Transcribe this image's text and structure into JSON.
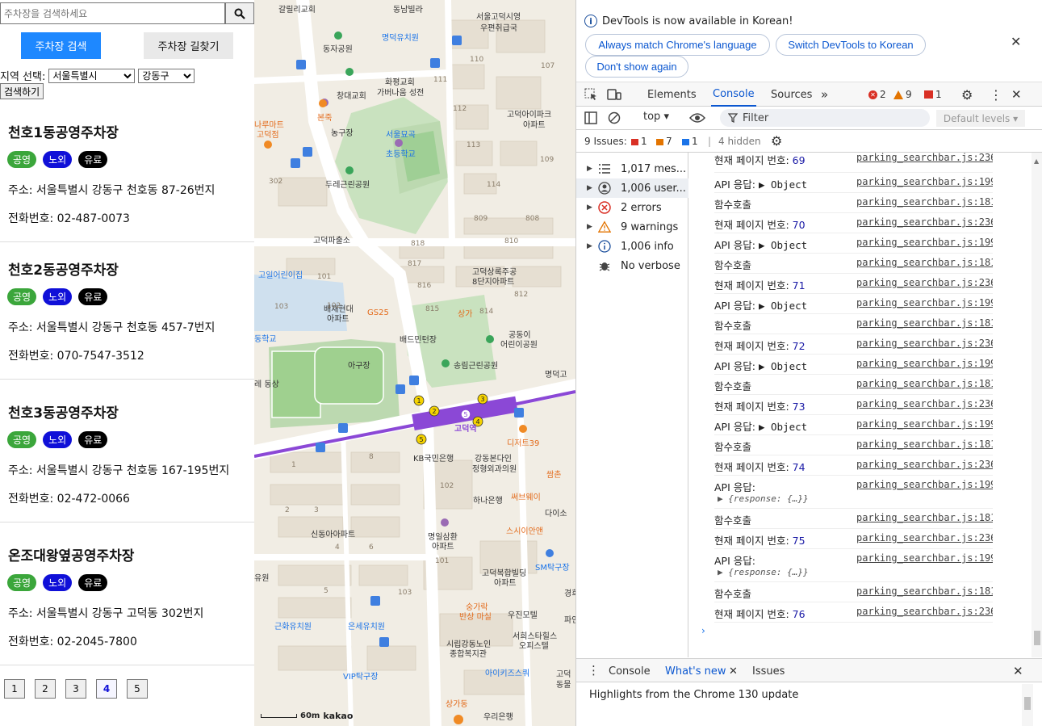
{
  "left": {
    "search_placeholder": "주차장을 검색하세요",
    "btn_search": "주차장 검색",
    "btn_route": "주차장 길찾기",
    "region_label": "지역 선택:",
    "city_selected": "서울특별시",
    "gu_selected": "강동구",
    "btn_search2": "검색하기",
    "cards": [
      {
        "title": "천호1동공영주차장",
        "badges": [
          "공영",
          "노외",
          "유료"
        ],
        "addr": "주소: 서울특별시 강동구 천호동 87-26번지",
        "tel": "전화번호: 02-487-0073"
      },
      {
        "title": "천호2동공영주차장",
        "badges": [
          "공영",
          "노외",
          "유료"
        ],
        "addr": "주소: 서울특별시 강동구 천호동 457-7번지",
        "tel": "전화번호: 070-7547-3512"
      },
      {
        "title": "천호3동공영주차장",
        "badges": [
          "공영",
          "노외",
          "유료"
        ],
        "addr": "주소: 서울특별시 강동구 천호동 167-195번지",
        "tel": "전화번호: 02-472-0066"
      },
      {
        "title": "온조대왕옆공영주차장",
        "badges": [
          "공영",
          "노외",
          "유료"
        ],
        "addr": "주소: 서울특별시 강동구 고덕동 302번지",
        "tel": "전화번호: 02-2045-7800"
      }
    ],
    "pages": [
      "1",
      "2",
      "3",
      "4",
      "5"
    ],
    "active_page": "4"
  },
  "map": {
    "labels": {
      "l0": "갈릴리교회",
      "l1": "동남빌라",
      "l2": "서울고덕시영",
      "l3": "우편취급국",
      "l4": "명덕유치원",
      "l5": "동자공원",
      "l6": "화평교회",
      "l7": "가버나움 성전",
      "l8": "창대교회",
      "l9": "고덕아이파크",
      "l10": "아파트",
      "l11": "본죽",
      "l12": "농구장",
      "l13": "나루마트",
      "l14": "고덕점",
      "l15": "서울묘곡",
      "l16": "초등학교",
      "l17": "두레근린공원",
      "l18": "고덕파출소",
      "l19": "고일어린이집",
      "l20": "고덕상록주공",
      "l21": "8단지아파트",
      "l22": "배재현대",
      "l23": "아파트",
      "l24": "GS25",
      "l25": "상가",
      "l26": "공동이",
      "l27": "어린이공원",
      "l28": "배드민턴장",
      "l29": "송림근린공원",
      "l30": "동학교",
      "l31": "아구장",
      "l32": "명덕고",
      "l33": "레 동상",
      "l34": "고덕역",
      "l35": "디저트39",
      "l36": "KB국민은행",
      "l37": "강동본다인",
      "l38": "정형외과의원",
      "l39": "쌈촌",
      "l40": "써브웨이",
      "l41": "하나은행",
      "l42": "다이소",
      "l43": "스시이안앤",
      "l44": "신동아아파트",
      "l45": "명일삼환",
      "l46": "아파트",
      "l47": "SM탁구장",
      "l48": "고덕복합빌딩",
      "l49": "아파트",
      "l50": "숭가락",
      "l51": "반상 마실",
      "l52": "우진모텔",
      "l53": "근화유치원",
      "l54": "은세유치원",
      "l55": "서희스타힐스",
      "l56": "오피스텔",
      "l57": "시립강동노인",
      "l58": "종합복지관",
      "l59": "VIP탁구장",
      "l60": "아이키즈스쿼",
      "l61": "고덕",
      "l62": "동물",
      "l63": "상가동",
      "l64": "우리은행",
      "l65": "파인",
      "l66": "경희",
      "l67": "유원"
    },
    "nums": [
      "110",
      "107",
      "111",
      "112",
      "113",
      "114",
      "109",
      "302",
      "809",
      "808",
      "818",
      "810",
      "817",
      "816",
      "815",
      "814",
      "812",
      "101",
      "102",
      "103",
      "8",
      "1",
      "2",
      "3",
      "6",
      "4",
      "5",
      "102",
      "101",
      "103"
    ],
    "scale_text": "60m",
    "brand": "kakao"
  },
  "devtools": {
    "info_text": "DevTools is now available in Korean!",
    "btn_match": "Always match Chrome's language",
    "btn_switch": "Switch DevTools to Korean",
    "btn_dont": "Don't show again",
    "tabs": {
      "elements": "Elements",
      "console": "Console",
      "sources": "Sources"
    },
    "counts": {
      "errors": "2",
      "warnings": "9",
      "issues": "1"
    },
    "context": "top",
    "filter_placeholder": "Filter",
    "levels": "Default levels",
    "issues_label": "9 Issues:",
    "issues_counts": {
      "red": "1",
      "orange": "7",
      "blue": "1"
    },
    "hidden": "4 hidden",
    "sidebar": [
      {
        "label": "1,017 mes...",
        "icon": "list-icon"
      },
      {
        "label": "1,006 user...",
        "icon": "user-icon"
      },
      {
        "label": "2 errors",
        "icon": "error-icon"
      },
      {
        "label": "9 warnings",
        "icon": "warning-icon"
      },
      {
        "label": "1,006 info",
        "icon": "info-icon"
      },
      {
        "label": "No verbose",
        "icon": "bug-icon"
      }
    ],
    "logs": [
      {
        "label": "현재 페이지 번호:",
        "value": "69",
        "src": "parking_searchbar.js:236"
      },
      {
        "label": "API 응답:",
        "value": "▶ Object",
        "src": "parking_searchbar.js:199"
      },
      {
        "label": "함수호출",
        "value": "",
        "src": "parking_searchbar.js:181"
      },
      {
        "label": "현재 페이지 번호:",
        "value": "70",
        "src": "parking_searchbar.js:236"
      },
      {
        "label": "API 응답:",
        "value": "▶ Object",
        "src": "parking_searchbar.js:199"
      },
      {
        "label": "함수호출",
        "value": "",
        "src": "parking_searchbar.js:181"
      },
      {
        "label": "현재 페이지 번호:",
        "value": "71",
        "src": "parking_searchbar.js:236"
      },
      {
        "label": "API 응답:",
        "value": "▶ Object",
        "src": "parking_searchbar.js:199"
      },
      {
        "label": "함수호출",
        "value": "",
        "src": "parking_searchbar.js:181"
      },
      {
        "label": "현재 페이지 번호:",
        "value": "72",
        "src": "parking_searchbar.js:236"
      },
      {
        "label": "API 응답:",
        "value": "▶ Object",
        "src": "parking_searchbar.js:199"
      },
      {
        "label": "함수호출",
        "value": "",
        "src": "parking_searchbar.js:181"
      },
      {
        "label": "현재 페이지 번호:",
        "value": "73",
        "src": "parking_searchbar.js:236"
      },
      {
        "label": "API 응답:",
        "value": "▶ Object",
        "src": "parking_searchbar.js:199"
      },
      {
        "label": "함수호출",
        "value": "",
        "src": "parking_searchbar.js:181"
      },
      {
        "label": "현재 페이지 번호:",
        "value": "74",
        "src": "parking_searchbar.js:236"
      },
      {
        "label": "API 응답:",
        "value": "",
        "sub": "▶ {response: {…}}",
        "src": "parking_searchbar.js:199"
      },
      {
        "label": "함수호출",
        "value": "",
        "src": "parking_searchbar.js:181"
      },
      {
        "label": "현재 페이지 번호:",
        "value": "75",
        "src": "parking_searchbar.js:236"
      },
      {
        "label": "API 응답:",
        "value": "",
        "sub": "▶ {response: {…}}",
        "src": "parking_searchbar.js:199"
      },
      {
        "label": "함수호출",
        "value": "",
        "src": "parking_searchbar.js:181"
      },
      {
        "label": "현재 페이지 번호:",
        "value": "76",
        "src": "parking_searchbar.js:236"
      }
    ],
    "prompt": "›",
    "drawer": {
      "console": "Console",
      "whatsnew": "What's new",
      "issues": "Issues"
    },
    "drawer_text": "Highlights from the Chrome 130 update"
  }
}
